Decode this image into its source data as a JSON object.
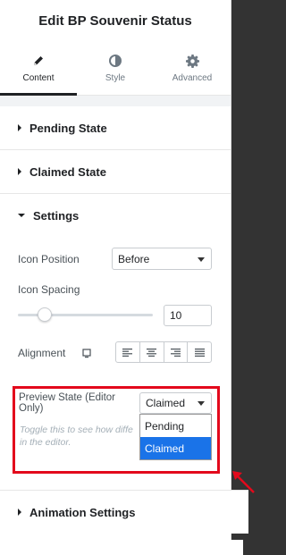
{
  "header": {
    "title": "Edit BP Souvenir Status"
  },
  "tabs": [
    {
      "label": "Content",
      "icon": "pencil-icon",
      "active": true
    },
    {
      "label": "Style",
      "icon": "contrast-icon",
      "active": false
    },
    {
      "label": "Advanced",
      "icon": "gear-icon",
      "active": false
    }
  ],
  "sections": {
    "pending": "Pending State",
    "claimed": "Claimed State",
    "settings": "Settings",
    "animation": "Animation Settings"
  },
  "settings": {
    "icon_position": {
      "label": "Icon Position",
      "value": "Before"
    },
    "icon_spacing": {
      "label": "Icon Spacing",
      "value": "10",
      "slider_fraction": 0.2
    },
    "alignment": {
      "label": "Alignment",
      "device_icon": "desktop-icon",
      "options": [
        "align-left-icon",
        "align-center-icon",
        "align-right-icon",
        "align-justify-icon"
      ]
    },
    "preview_state": {
      "label": "Preview State (Editor Only)",
      "value": "Claimed",
      "help": "Toggle this to see how diffe in the editor.",
      "help_line1": "Toggle this to see how diffe",
      "help_line2": "in the editor.",
      "options": [
        "Pending",
        "Claimed"
      ],
      "selected_option": "Claimed"
    }
  },
  "colors": {
    "highlight": "#e3091c",
    "selected_option": "#1a73e8",
    "backdrop": "#333333"
  }
}
